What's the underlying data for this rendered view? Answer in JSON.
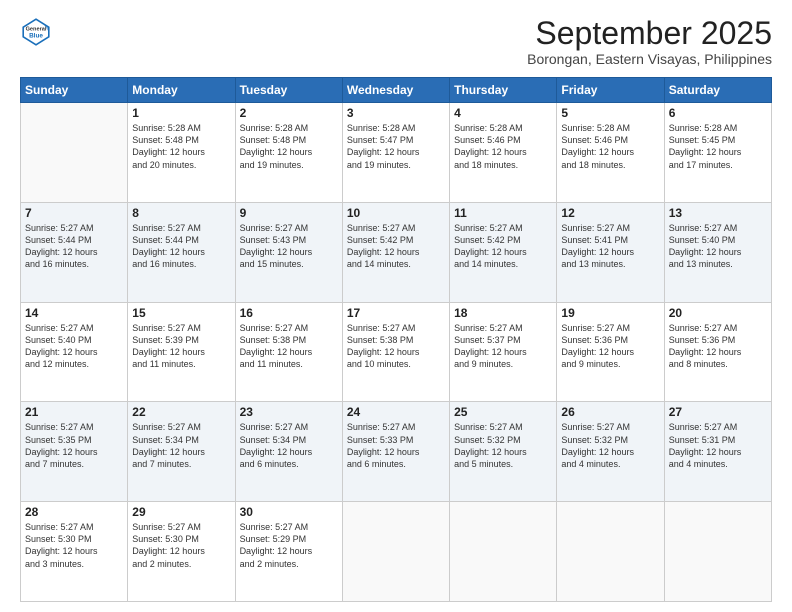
{
  "header": {
    "logo": {
      "general": "General",
      "blue": "Blue"
    },
    "title": "September 2025",
    "location": "Borongan, Eastern Visayas, Philippines"
  },
  "days_of_week": [
    "Sunday",
    "Monday",
    "Tuesday",
    "Wednesday",
    "Thursday",
    "Friday",
    "Saturday"
  ],
  "weeks": [
    [
      {
        "day": "",
        "info": ""
      },
      {
        "day": "1",
        "info": "Sunrise: 5:28 AM\nSunset: 5:48 PM\nDaylight: 12 hours\nand 20 minutes."
      },
      {
        "day": "2",
        "info": "Sunrise: 5:28 AM\nSunset: 5:48 PM\nDaylight: 12 hours\nand 19 minutes."
      },
      {
        "day": "3",
        "info": "Sunrise: 5:28 AM\nSunset: 5:47 PM\nDaylight: 12 hours\nand 19 minutes."
      },
      {
        "day": "4",
        "info": "Sunrise: 5:28 AM\nSunset: 5:46 PM\nDaylight: 12 hours\nand 18 minutes."
      },
      {
        "day": "5",
        "info": "Sunrise: 5:28 AM\nSunset: 5:46 PM\nDaylight: 12 hours\nand 18 minutes."
      },
      {
        "day": "6",
        "info": "Sunrise: 5:28 AM\nSunset: 5:45 PM\nDaylight: 12 hours\nand 17 minutes."
      }
    ],
    [
      {
        "day": "7",
        "info": "Sunrise: 5:27 AM\nSunset: 5:44 PM\nDaylight: 12 hours\nand 16 minutes."
      },
      {
        "day": "8",
        "info": "Sunrise: 5:27 AM\nSunset: 5:44 PM\nDaylight: 12 hours\nand 16 minutes."
      },
      {
        "day": "9",
        "info": "Sunrise: 5:27 AM\nSunset: 5:43 PM\nDaylight: 12 hours\nand 15 minutes."
      },
      {
        "day": "10",
        "info": "Sunrise: 5:27 AM\nSunset: 5:42 PM\nDaylight: 12 hours\nand 14 minutes."
      },
      {
        "day": "11",
        "info": "Sunrise: 5:27 AM\nSunset: 5:42 PM\nDaylight: 12 hours\nand 14 minutes."
      },
      {
        "day": "12",
        "info": "Sunrise: 5:27 AM\nSunset: 5:41 PM\nDaylight: 12 hours\nand 13 minutes."
      },
      {
        "day": "13",
        "info": "Sunrise: 5:27 AM\nSunset: 5:40 PM\nDaylight: 12 hours\nand 13 minutes."
      }
    ],
    [
      {
        "day": "14",
        "info": "Sunrise: 5:27 AM\nSunset: 5:40 PM\nDaylight: 12 hours\nand 12 minutes."
      },
      {
        "day": "15",
        "info": "Sunrise: 5:27 AM\nSunset: 5:39 PM\nDaylight: 12 hours\nand 11 minutes."
      },
      {
        "day": "16",
        "info": "Sunrise: 5:27 AM\nSunset: 5:38 PM\nDaylight: 12 hours\nand 11 minutes."
      },
      {
        "day": "17",
        "info": "Sunrise: 5:27 AM\nSunset: 5:38 PM\nDaylight: 12 hours\nand 10 minutes."
      },
      {
        "day": "18",
        "info": "Sunrise: 5:27 AM\nSunset: 5:37 PM\nDaylight: 12 hours\nand 9 minutes."
      },
      {
        "day": "19",
        "info": "Sunrise: 5:27 AM\nSunset: 5:36 PM\nDaylight: 12 hours\nand 9 minutes."
      },
      {
        "day": "20",
        "info": "Sunrise: 5:27 AM\nSunset: 5:36 PM\nDaylight: 12 hours\nand 8 minutes."
      }
    ],
    [
      {
        "day": "21",
        "info": "Sunrise: 5:27 AM\nSunset: 5:35 PM\nDaylight: 12 hours\nand 7 minutes."
      },
      {
        "day": "22",
        "info": "Sunrise: 5:27 AM\nSunset: 5:34 PM\nDaylight: 12 hours\nand 7 minutes."
      },
      {
        "day": "23",
        "info": "Sunrise: 5:27 AM\nSunset: 5:34 PM\nDaylight: 12 hours\nand 6 minutes."
      },
      {
        "day": "24",
        "info": "Sunrise: 5:27 AM\nSunset: 5:33 PM\nDaylight: 12 hours\nand 6 minutes."
      },
      {
        "day": "25",
        "info": "Sunrise: 5:27 AM\nSunset: 5:32 PM\nDaylight: 12 hours\nand 5 minutes."
      },
      {
        "day": "26",
        "info": "Sunrise: 5:27 AM\nSunset: 5:32 PM\nDaylight: 12 hours\nand 4 minutes."
      },
      {
        "day": "27",
        "info": "Sunrise: 5:27 AM\nSunset: 5:31 PM\nDaylight: 12 hours\nand 4 minutes."
      }
    ],
    [
      {
        "day": "28",
        "info": "Sunrise: 5:27 AM\nSunset: 5:30 PM\nDaylight: 12 hours\nand 3 minutes."
      },
      {
        "day": "29",
        "info": "Sunrise: 5:27 AM\nSunset: 5:30 PM\nDaylight: 12 hours\nand 2 minutes."
      },
      {
        "day": "30",
        "info": "Sunrise: 5:27 AM\nSunset: 5:29 PM\nDaylight: 12 hours\nand 2 minutes."
      },
      {
        "day": "",
        "info": ""
      },
      {
        "day": "",
        "info": ""
      },
      {
        "day": "",
        "info": ""
      },
      {
        "day": "",
        "info": ""
      }
    ]
  ]
}
